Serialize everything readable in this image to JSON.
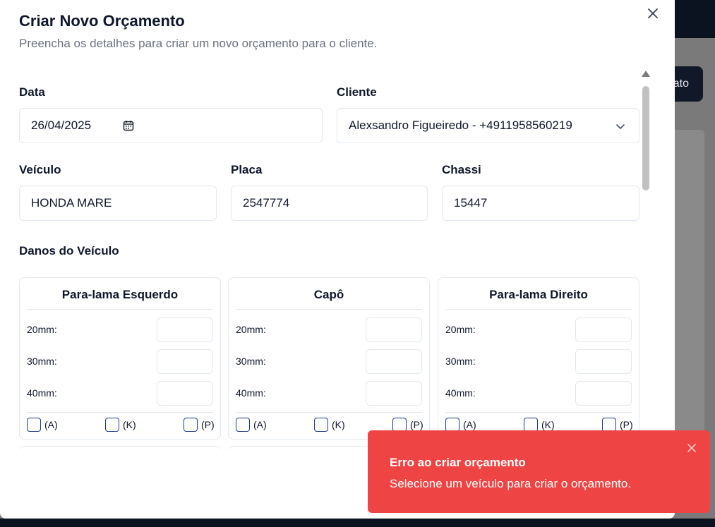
{
  "background": {
    "button_label": "ato"
  },
  "modal": {
    "title": "Criar Novo Orçamento",
    "description": "Preencha os detalhes para criar um novo orçamento para o cliente.",
    "close_icon": "close-icon",
    "fields": {
      "data_label": "Data",
      "data_value": "26/04/2025",
      "cliente_label": "Cliente",
      "cliente_value": "Alexsandro Figueiredo - +4911958560219",
      "veiculo_label": "Veículo",
      "veiculo_value": "HONDA MARE",
      "placa_label": "Placa",
      "placa_value": "2547774",
      "chassi_label": "Chassi",
      "chassi_value": "15447"
    },
    "damages_title": "Danos do Veículo",
    "cards": [
      {
        "title": "Para-lama Esquerdo",
        "rows": [
          "20mm:",
          "30mm:",
          "40mm:"
        ],
        "checks": [
          "(A)",
          "(K)",
          "(P)"
        ]
      },
      {
        "title": "Capô",
        "rows": [
          "20mm:",
          "30mm:",
          "40mm:"
        ],
        "checks": [
          "(A)",
          "(K)",
          "(P)"
        ]
      },
      {
        "title": "Para-lama Direito",
        "rows": [
          "20mm:",
          "30mm:",
          "40mm:"
        ],
        "checks": [
          "(A)",
          "(K)",
          "(P)"
        ]
      }
    ]
  },
  "toast": {
    "title": "Erro ao criar orçamento",
    "message": "Selecione um veículo para criar o orçamento.",
    "color": "#ef4444"
  }
}
